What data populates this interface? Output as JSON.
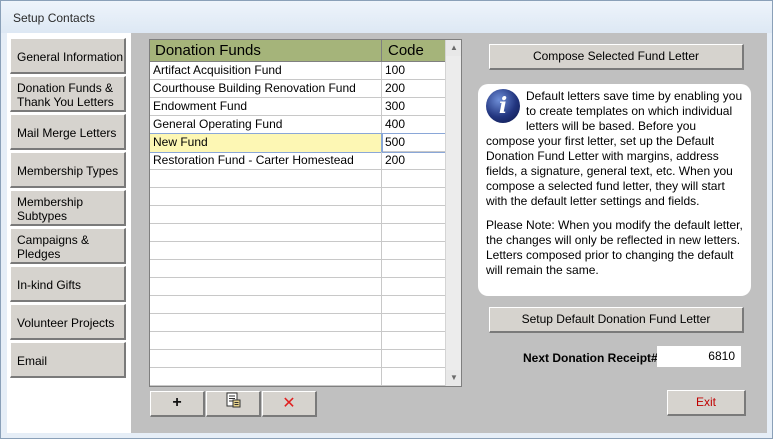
{
  "window": {
    "title": "Setup Contacts"
  },
  "sidebar": {
    "items": [
      {
        "label": "General Information"
      },
      {
        "label": "Donation Funds & Thank You Letters"
      },
      {
        "label": "Mail Merge Letters"
      },
      {
        "label": "Membership Types"
      },
      {
        "label": "Membership Subtypes"
      },
      {
        "label": "Campaigns & Pledges"
      },
      {
        "label": "In-kind Gifts"
      },
      {
        "label": "Volunteer Projects"
      },
      {
        "label": "Email"
      }
    ]
  },
  "grid": {
    "columns": [
      "Donation Funds",
      "Code"
    ],
    "rows": [
      {
        "fund": "Artifact Acquisition Fund",
        "code": "100"
      },
      {
        "fund": "Courthouse Building Renovation Fund",
        "code": "200"
      },
      {
        "fund": "Endowment Fund",
        "code": "300"
      },
      {
        "fund": "General Operating Fund",
        "code": "400"
      },
      {
        "fund": "New Fund",
        "code": "500"
      },
      {
        "fund": "Restoration Fund - Carter Homestead",
        "code": "200"
      }
    ],
    "selected_index": 4,
    "empty_rows": 12
  },
  "toolbar": {
    "add_glyph": "+",
    "delete_glyph": "✕",
    "icons": [
      "plus-icon",
      "document-edit-icon",
      "delete-x-icon"
    ]
  },
  "actions": {
    "compose_label": "Compose Selected Fund Letter",
    "setup_default_label": "Setup Default Donation Fund Letter",
    "exit_label": "Exit"
  },
  "info": {
    "icon_glyph": "i",
    "p1": "Default letters save time by enabling you to create templates on which individual letters will be based. Before you compose your first letter, set up the Default Donation Fund Letter with margins, address fields, a signature, general text, etc. When you compose a selected fund letter, they will start with the default letter settings and fields.",
    "p2": "Please Note:  When you modify the default letter, the changes will only be reflected in new letters. Letters composed prior to changing the default will remain the same."
  },
  "receipt": {
    "label": "Next Donation Receipt#",
    "value": "6810"
  },
  "colors": {
    "grid_header": "#a5b47a",
    "selected_row": "#fdf7b4",
    "exit_text": "#c00000",
    "delete_icon": "#e02020"
  }
}
